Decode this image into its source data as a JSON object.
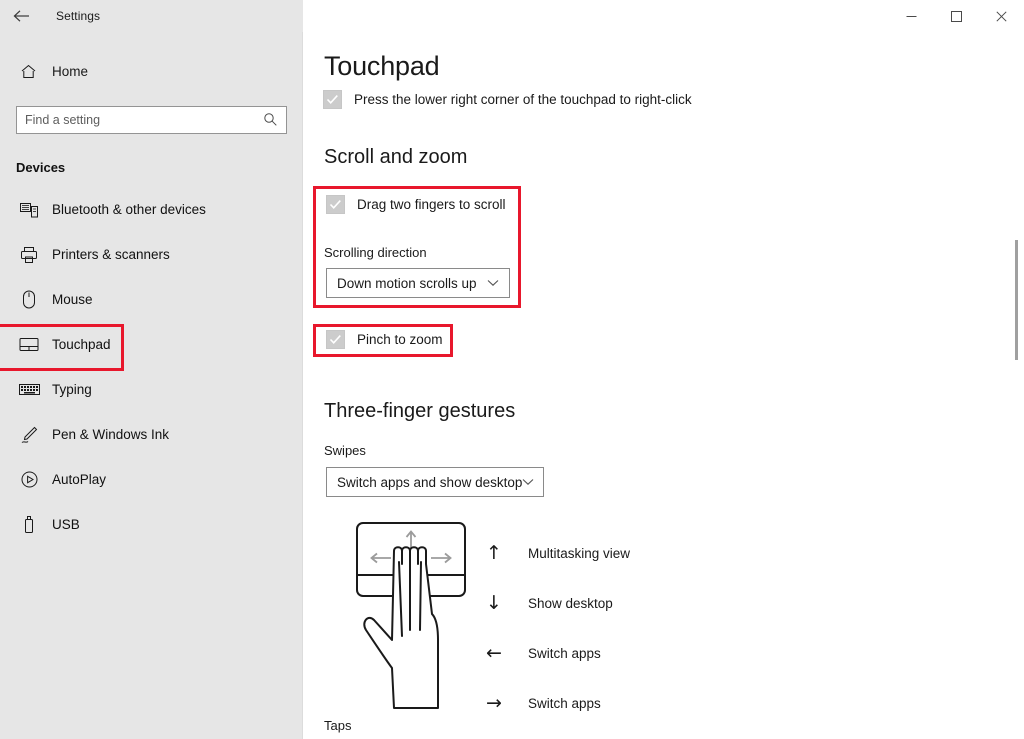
{
  "window": {
    "app_title": "Settings",
    "back_icon": "back-arrow-icon",
    "minimize_label": "─",
    "maximize_label": "☐",
    "close_label": "✕"
  },
  "sidebar": {
    "home_label": "Home",
    "search": {
      "placeholder": "Find a setting",
      "value": "",
      "icon": "search-icon"
    },
    "group_heading": "Devices",
    "items": [
      {
        "label": "Bluetooth & other devices",
        "icon": "bluetooth-devices-icon",
        "selected": false
      },
      {
        "label": "Printers & scanners",
        "icon": "printer-icon",
        "selected": false
      },
      {
        "label": "Mouse",
        "icon": "mouse-icon",
        "selected": false
      },
      {
        "label": "Touchpad",
        "icon": "touchpad-icon",
        "selected": true
      },
      {
        "label": "Typing",
        "icon": "keyboard-icon",
        "selected": false
      },
      {
        "label": "Pen & Windows Ink",
        "icon": "pen-icon",
        "selected": false
      },
      {
        "label": "AutoPlay",
        "icon": "autoplay-icon",
        "selected": false
      },
      {
        "label": "USB",
        "icon": "usb-icon",
        "selected": false
      }
    ]
  },
  "main": {
    "page_title": "Touchpad",
    "right_click_checkbox": {
      "label": "Press the lower right corner of the touchpad to right-click",
      "checked": true
    },
    "scroll_and_zoom": {
      "heading": "Scroll and zoom",
      "drag_two_fingers": {
        "label": "Drag two fingers to scroll",
        "checked": true
      },
      "scrolling_direction": {
        "label": "Scrolling direction",
        "value": "Down motion scrolls up"
      },
      "pinch_to_zoom": {
        "label": "Pinch to zoom",
        "checked": true
      }
    },
    "three_finger_gestures": {
      "heading": "Three-finger gestures",
      "swipes": {
        "label": "Swipes",
        "value": "Switch apps and show desktop"
      },
      "legend": [
        {
          "arrow": "↑",
          "icon": "arrow-up-icon",
          "text": "Multitasking view"
        },
        {
          "arrow": "↓",
          "icon": "arrow-down-icon",
          "text": "Show desktop"
        },
        {
          "arrow": "←",
          "icon": "arrow-left-icon",
          "text": "Switch apps"
        },
        {
          "arrow": "→",
          "icon": "arrow-right-icon",
          "text": "Switch apps"
        }
      ],
      "taps_label": "Taps"
    }
  },
  "colors": {
    "highlight": "#e8172c",
    "sidebar_bg": "#e6e6e6",
    "content_bg": "#ffffff",
    "text": "#1a1a1a"
  }
}
